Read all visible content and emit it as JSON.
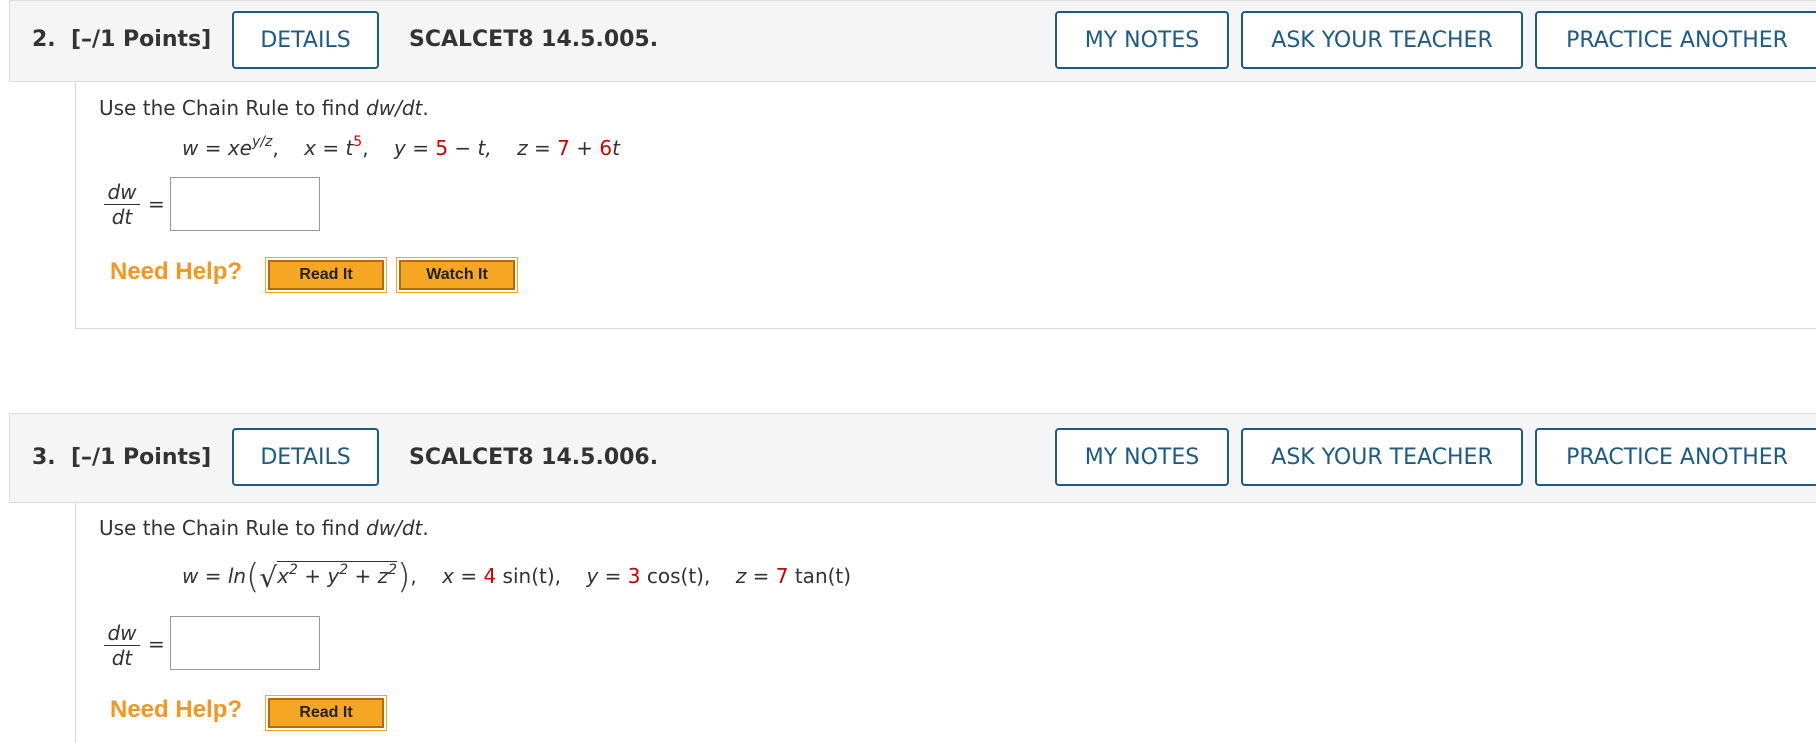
{
  "buttons": {
    "details": "DETAILS",
    "my_notes": "MY NOTES",
    "ask_teacher": "ASK YOUR TEACHER",
    "practice_another": "PRACTICE ANOTHER",
    "read_it": "Read It",
    "watch_it": "Watch It"
  },
  "need_help": "Need Help?",
  "equals": "=",
  "fraction": {
    "num": "dw",
    "den": "dt"
  },
  "questions": [
    {
      "number": "2.",
      "points": "[–/1 Points]",
      "code": "SCALCET8 14.5.005.",
      "prompt": {
        "prefix": "Use the Chain Rule to find ",
        "expr": "dw/dt",
        "suffix": "."
      },
      "equation": {
        "w": "w = xe",
        "w_exp": "y/z",
        "sep1": ",",
        "x": "x = t",
        "x_exp": "5",
        "sep2": ",",
        "y_pre": "y = ",
        "y_const": "5",
        "y_post": " − t,",
        "z_pre": "z = ",
        "z_const": "7",
        "z_mid": " + ",
        "z_coef": "6",
        "z_var": "t"
      },
      "answer": ""
    },
    {
      "number": "3.",
      "points": "[–/1 Points]",
      "code": "SCALCET8 14.5.006.",
      "prompt": {
        "prefix": "Use the Chain Rule to find ",
        "expr": "dw/dt",
        "suffix": "."
      },
      "equation": {
        "w_pre": "w = ln",
        "rad": "x",
        "rad_e1": "2",
        "rad_p1": " + y",
        "rad_e2": "2",
        "rad_p2": " + z",
        "rad_e3": "2",
        "sep": ",",
        "x_pre": "x = ",
        "x_const": "4",
        "x_post": " sin(t),",
        "y_pre": "y = ",
        "y_const": "3",
        "y_post": " cos(t),",
        "z_pre": "z = ",
        "z_const": "7",
        "z_post": " tan(t)"
      },
      "answer": ""
    }
  ]
}
